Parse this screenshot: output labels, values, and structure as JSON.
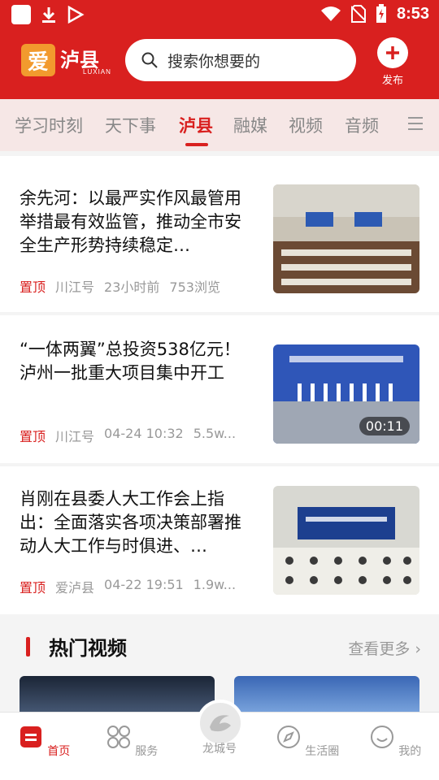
{
  "status_bar": {
    "time": "8:53"
  },
  "header": {
    "logo_char": "爱",
    "logo_name": "泸县",
    "logo_sub": "LUXIAN",
    "search_placeholder": "搜索你想要的",
    "publish_label": "发布"
  },
  "tabs": [
    {
      "label": "学习时刻",
      "active": false
    },
    {
      "label": "天下事",
      "active": false
    },
    {
      "label": "泸县",
      "active": true
    },
    {
      "label": "融媒",
      "active": false
    },
    {
      "label": "视频",
      "active": false
    },
    {
      "label": "音频",
      "active": false
    }
  ],
  "news": [
    {
      "title": "余先河：以最严实作风最管用举措最有效监管，推动全市安全生产形势持续稳定…",
      "pin": "置顶",
      "source": "川江号",
      "time": "23小时前",
      "views": "753浏览"
    },
    {
      "title": "“一体两翼”总投资538亿元！泸州一批重大项目集中开工",
      "pin": "置顶",
      "source": "川江号",
      "time": "04-24 10:32",
      "views": "5.5w...",
      "duration": "00:11"
    },
    {
      "title": "肖刚在县委人大工作会上指出：全面落实各项决策部署推动人大工作与时俱进、…",
      "pin": "置顶",
      "source": "爱泸县",
      "time": "04-22 19:51",
      "views": "1.9w..."
    }
  ],
  "hot_videos": {
    "heading": "热门视频",
    "more": "查看更多 ›"
  },
  "bottom_nav": [
    {
      "label": "首页",
      "active": true
    },
    {
      "label": "服务",
      "active": false
    },
    {
      "label": "龙城号",
      "active": false
    },
    {
      "label": "生活圈",
      "active": false
    },
    {
      "label": "我的",
      "active": false
    }
  ],
  "colors": {
    "brand_red": "#d9201f",
    "logo_orange": "#f29a2e"
  }
}
